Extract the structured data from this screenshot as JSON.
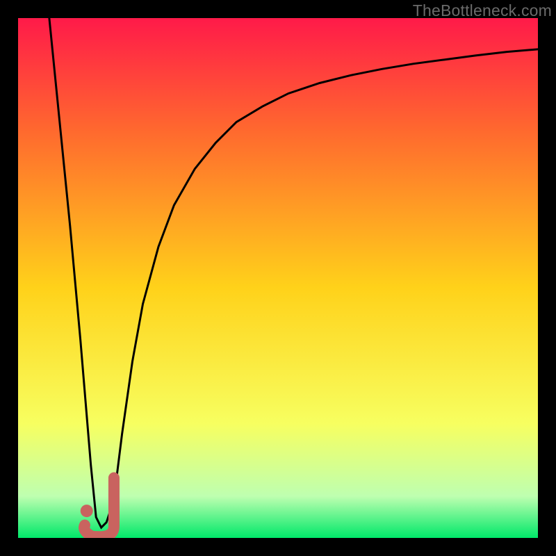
{
  "watermark": "TheBottleneck.com",
  "colors": {
    "frame": "#000000",
    "gradient_top": "#ff1a49",
    "gradient_upper_mid": "#ff6a2e",
    "gradient_mid": "#ffd21a",
    "gradient_lower_mid": "#f7ff60",
    "gradient_near_bottom": "#beffb0",
    "gradient_bottom": "#00e869",
    "curve_stroke": "#000000",
    "marker_fill": "#c9635f",
    "marker_stroke": "#c9635f"
  },
  "chart_data": {
    "type": "line",
    "title": "",
    "xlabel": "",
    "ylabel": "",
    "xlim": [
      0,
      100
    ],
    "ylim": [
      0,
      100
    ],
    "notes": "V-shaped bottleneck curve. Y-axis visually maps to a red→green gradient (red ≈ bad/high, green ≈ good/low). The minimum (best match) is near x ≈ 15. No numeric axis ticks are rendered in the source image; all numeric values below are estimates read from the curve geometry.",
    "series": [
      {
        "name": "bottleneck-curve",
        "x": [
          6,
          8,
          10,
          12,
          13,
          14,
          15,
          16,
          17,
          18,
          19,
          20,
          22,
          24,
          27,
          30,
          34,
          38,
          42,
          47,
          52,
          58,
          64,
          70,
          76,
          82,
          88,
          94,
          100
        ],
        "y": [
          100,
          80,
          60,
          38,
          26,
          14,
          4,
          2,
          3,
          6,
          12,
          20,
          34,
          45,
          56,
          64,
          71,
          76,
          80,
          83,
          85.5,
          87.5,
          89,
          90.2,
          91.2,
          92,
          92.8,
          93.5,
          94
        ]
      }
    ],
    "optimum_marker": {
      "shape": "J",
      "center_x": 15.5,
      "center_y": 3,
      "dot": {
        "x": 13.2,
        "y": 5.2
      }
    }
  }
}
